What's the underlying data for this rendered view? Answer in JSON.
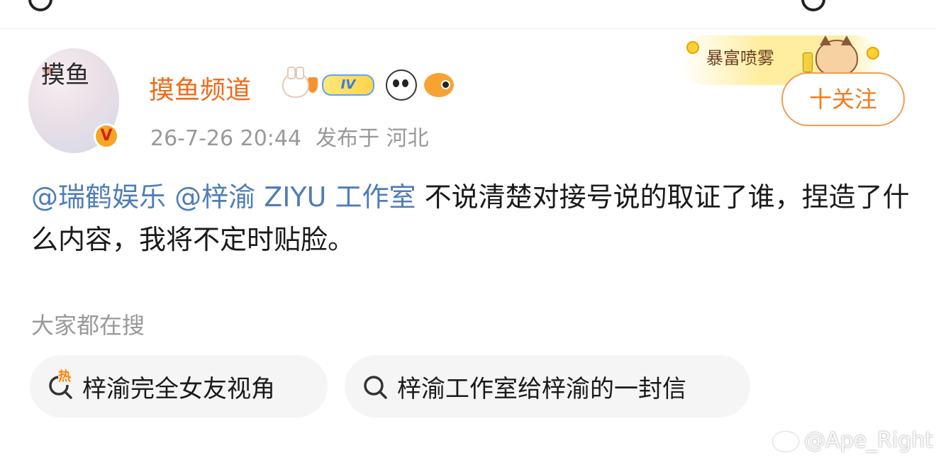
{
  "author": {
    "name": "摸鱼频道",
    "avatar_text": "摸鱼",
    "level_badge": "IV",
    "verified_mark": "V"
  },
  "post": {
    "date": "26-7-26 20:44",
    "location": "发布于 河北",
    "mentions": [
      "@瑞鹤娱乐",
      "@梓渝 ZIYU 工作室"
    ],
    "body": "不说清楚对接号说的取证了谁，捏造了什么内容，我将不定时贴脸。"
  },
  "follow_button": {
    "label": "十关注"
  },
  "promo_sticker": {
    "text": "暴富喷雾"
  },
  "trending": {
    "label": "大家都在搜",
    "hot_tag": "热",
    "items": [
      "梓渝完全女友视角",
      "梓渝工作室给梓渝的一封信"
    ]
  },
  "watermark": {
    "text": "@Ape_Right"
  },
  "colors": {
    "name": "#ef6b19",
    "mention": "#4f7db8",
    "follow": "#f07c1f",
    "meta": "#999999",
    "chip_bg": "#f5f5f5"
  },
  "icons": [
    "rabbit-badge-icon",
    "level-badge-icon",
    "panda-badge-icon",
    "fish-badge-icon",
    "search-icon",
    "hot-search-icon"
  ]
}
